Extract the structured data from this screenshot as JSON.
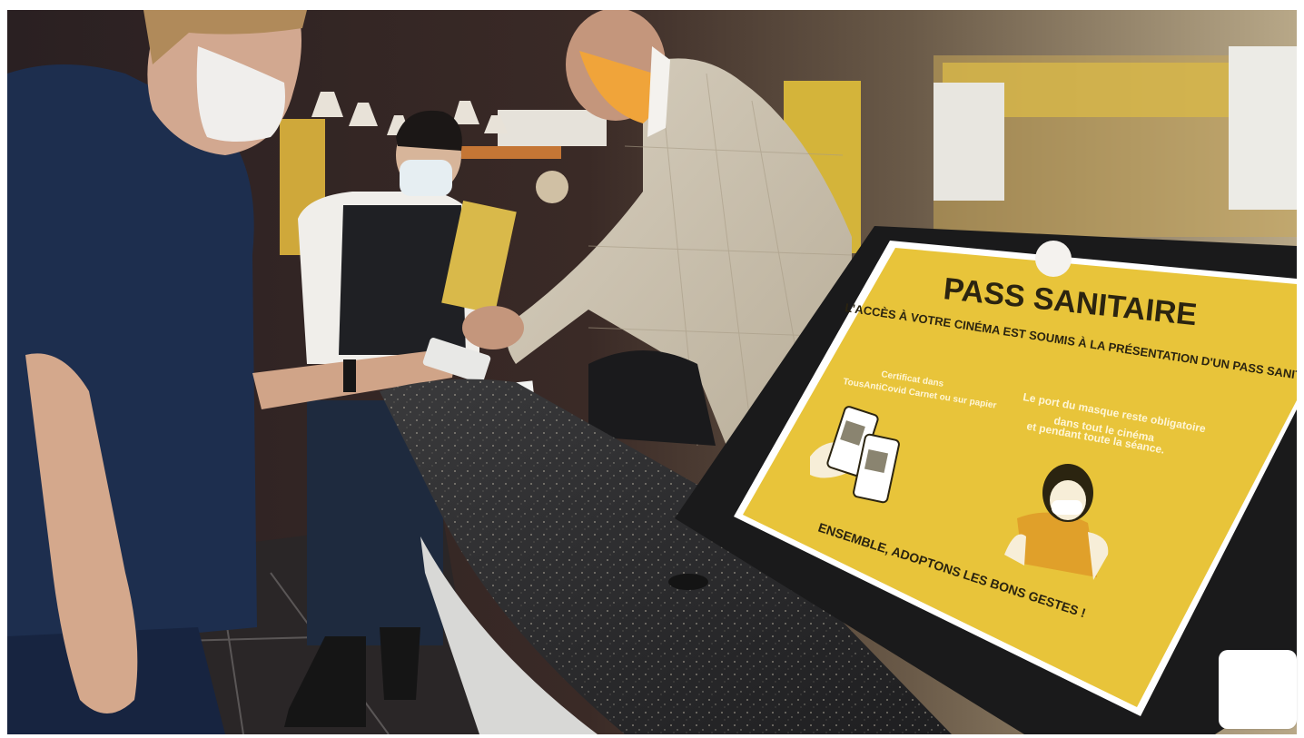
{
  "photo": {
    "alt": "",
    "sign": {
      "title": "PASS SANITAIRE",
      "subtitle": "L'ACCÈS À VOTRE CINÉMA EST SOUMIS À LA PRÉSENTATION D'UN PASS SANITAIRE VALIDE",
      "left_caption_line1": "Certificat dans",
      "left_caption_line2": "TousAntiCovid Carnet ou sur papier",
      "right_caption_line1": "Le port du masque reste obligatoire",
      "right_caption_line2": "dans tout le cinéma",
      "right_caption_line3": "et pendant toute la séance.",
      "footer": "ENSEMBLE, ADOPTONS LES BONS GESTES !"
    }
  },
  "colors": {
    "sign_yellow": "#e8c43a",
    "counter": "#2a2a2c",
    "background": "#ffffff"
  }
}
